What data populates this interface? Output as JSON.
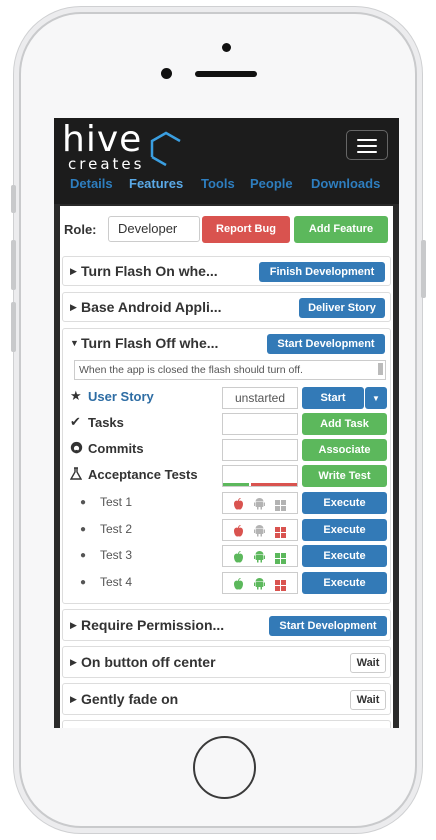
{
  "app": {
    "logo_text": "hive",
    "logo_sub": "creates",
    "tabs": [
      "Details",
      "Features",
      "Tools",
      "People",
      "Downloads"
    ],
    "active_tab": "Features"
  },
  "role": {
    "label": "Role:",
    "value": "Developer",
    "report_bug": "Report Bug",
    "add_feature": "Add Feature"
  },
  "features": [
    {
      "title": "Turn Flash On whe...",
      "action": "Finish Development",
      "action_style": "blue"
    },
    {
      "title": "Base Android Appli...",
      "action": "Deliver Story",
      "action_style": "blue"
    },
    {
      "title": "Turn Flash Off whe...",
      "action": "Start Development",
      "action_style": "blue",
      "expanded": true
    },
    {
      "title": "Require Permission...",
      "action": "Start Development",
      "action_style": "blue"
    },
    {
      "title": "On button off center",
      "action": "Wait",
      "action_style": "wait"
    },
    {
      "title": "Gently fade on",
      "action": "Wait",
      "action_style": "wait"
    }
  ],
  "expanded": {
    "description": "When the app is closed the flash should turn off.",
    "user_story": {
      "label": "User Story",
      "status": "unstarted",
      "button": "Start"
    },
    "tasks": {
      "label": "Tasks",
      "button": "Add Task"
    },
    "commits": {
      "label": "Commits",
      "button": "Associate"
    },
    "acceptance": {
      "label": "Acceptance Tests",
      "button": "Write Test",
      "progress": {
        "pass_fraction": 0.35,
        "fail_fraction": 0.65
      }
    },
    "tests": [
      {
        "label": "Test 1",
        "button": "Execute",
        "apple": "red",
        "android": "gray",
        "windows": "gray"
      },
      {
        "label": "Test 2",
        "button": "Execute",
        "apple": "red",
        "android": "gray",
        "windows": "red"
      },
      {
        "label": "Test 3",
        "button": "Execute",
        "apple": "green",
        "android": "green",
        "windows": "green"
      },
      {
        "label": "Test 4",
        "button": "Execute",
        "apple": "green",
        "android": "green",
        "windows": "red"
      }
    ]
  },
  "colors": {
    "red": "#d9534f",
    "green": "#5cb85c",
    "gray": "#b3b3b3",
    "blue": "#337ab7",
    "tab_link": "#2e7ebf"
  }
}
